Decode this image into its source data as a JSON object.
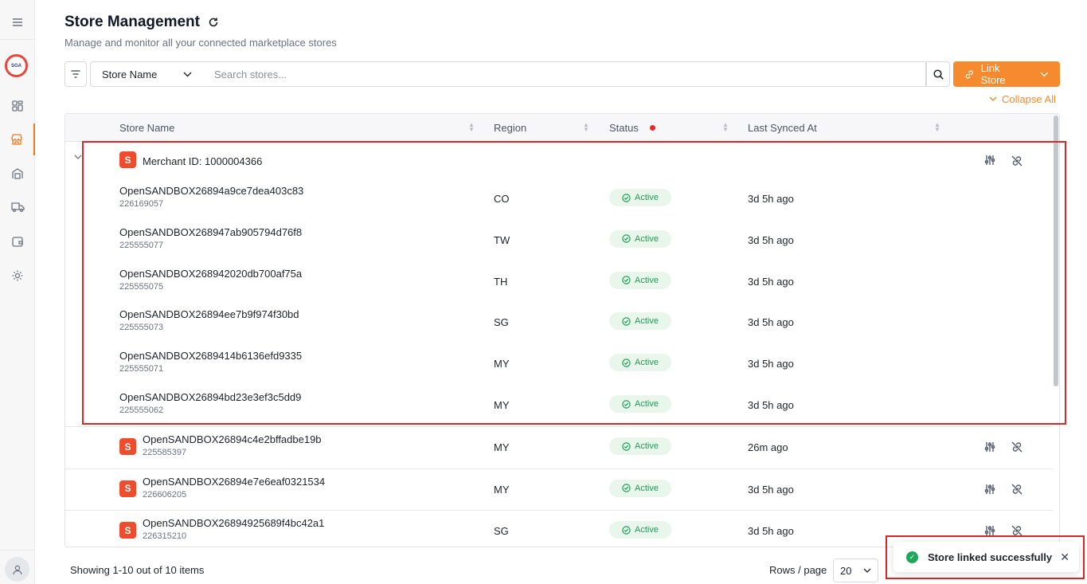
{
  "header": {
    "title": "Store Management",
    "subtitle": "Manage and monitor all your connected marketplace stores"
  },
  "toolbar": {
    "select_value": "Store Name",
    "search_placeholder": "Search stores...",
    "link_label": "Link Store",
    "collapse_label": "Collapse All"
  },
  "table": {
    "columns": [
      "Store Name",
      "Region",
      "Status",
      "Last Synced At"
    ],
    "group": {
      "title": "Merchant ID: 1000004366",
      "rows": [
        {
          "name": "OpenSANDBOX26894a9ce7dea403c83",
          "id": "226169057",
          "region": "CO",
          "status": "Active",
          "synced": "3d 5h ago"
        },
        {
          "name": "OpenSANDBOX268947ab905794d76f8",
          "id": "225555077",
          "region": "TW",
          "status": "Active",
          "synced": "3d 5h ago"
        },
        {
          "name": "OpenSANDBOX268942020db700af75a",
          "id": "225555075",
          "region": "TH",
          "status": "Active",
          "synced": "3d 5h ago"
        },
        {
          "name": "OpenSANDBOX26894ee7b9f974f30bd",
          "id": "225555073",
          "region": "SG",
          "status": "Active",
          "synced": "3d 5h ago"
        },
        {
          "name": "OpenSANDBOX2689414b6136efd9335",
          "id": "225555071",
          "region": "MY",
          "status": "Active",
          "synced": "3d 5h ago"
        },
        {
          "name": "OpenSANDBOX26894bd23e3ef3c5dd9",
          "id": "225555062",
          "region": "MY",
          "status": "Active",
          "synced": "3d 5h ago"
        }
      ]
    },
    "stores": [
      {
        "name": "OpenSANDBOX26894c4e2bffadbe19b",
        "id": "225585397",
        "region": "MY",
        "status": "Active",
        "synced": "26m ago"
      },
      {
        "name": "OpenSANDBOX26894e7e6eaf0321534",
        "id": "226606205",
        "region": "MY",
        "status": "Active",
        "synced": "3d 5h ago"
      },
      {
        "name": "OpenSANDBOX26894925689f4bc42a1",
        "id": "226315210",
        "region": "SG",
        "status": "Active",
        "synced": "3d 5h ago"
      }
    ]
  },
  "footer": {
    "summary": "Showing 1-10 out of 10 items",
    "rows_label": "Rows / page",
    "rows_value": "20"
  },
  "toast": {
    "message": "Store linked successfully"
  },
  "colors": {
    "accent": "#f58a2e",
    "status_active_bg": "#e8f6ec",
    "status_active_text": "#1f9d55",
    "shopee": "#ee4d2d",
    "highlight": "#d62828"
  },
  "icons": {
    "sidebar": [
      "menu-icon",
      "logo",
      "dashboard-icon",
      "store-icon",
      "warehouse-icon",
      "truck-icon",
      "wallet-icon",
      "gear-icon",
      "user-icon"
    ]
  }
}
